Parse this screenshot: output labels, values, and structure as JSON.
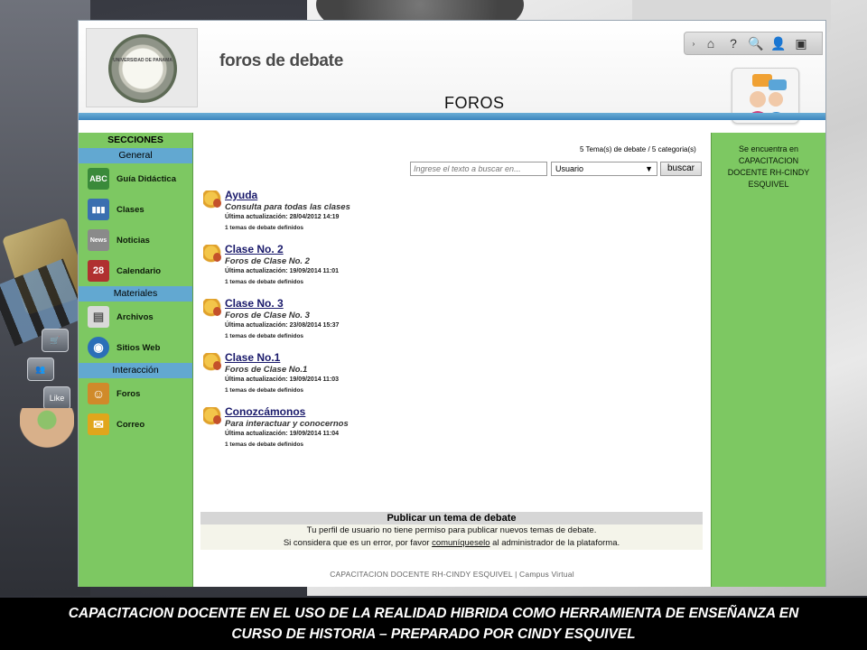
{
  "header": {
    "app_title": "foros de debate",
    "page_title": "FOROS",
    "logo_text": "UNIVERSIDAD DE PANAMA"
  },
  "toolbar": {
    "icons": [
      "chevron-right-icon",
      "home-icon",
      "help-icon",
      "search-icon",
      "user-icon",
      "profile-card-icon"
    ],
    "glyphs": [
      "›",
      "⌂",
      "?",
      "🔍",
      "👤",
      "▣"
    ]
  },
  "search": {
    "placeholder": "Ingrese el texto a buscar en...",
    "select_value": "Usuario",
    "button_label": "buscar"
  },
  "stats": {
    "text": "5 Tema(s) de debate /   5 categoria(s)"
  },
  "sidebar": {
    "title": "SECCIONES",
    "sections": [
      {
        "label": "General",
        "items": [
          {
            "label": "Guía Didáctica",
            "icon": "abc-book-icon",
            "glyph": "ABC",
            "color": "#3a8a3a"
          },
          {
            "label": "Clases",
            "icon": "binders-icon",
            "glyph": "▮▮▮",
            "color": "#3a6fb0"
          },
          {
            "label": "Noticias",
            "icon": "news-icon",
            "glyph": "News",
            "color": "#8a8a8a"
          },
          {
            "label": "Calendario",
            "icon": "calendar-icon",
            "glyph": "28",
            "color": "#b03030"
          }
        ]
      },
      {
        "label": "Materiales",
        "items": [
          {
            "label": "Archivos",
            "icon": "documents-icon",
            "glyph": "▤",
            "color": "#d9d9d9"
          },
          {
            "label": "Sitios Web",
            "icon": "globe-icon",
            "glyph": "◉",
            "color": "#2b6fb8"
          }
        ]
      },
      {
        "label": "Interacción",
        "items": [
          {
            "label": "Foros",
            "icon": "forum-users-icon",
            "glyph": "☺",
            "color": "#d08a2a"
          },
          {
            "label": "Correo",
            "icon": "envelope-icon",
            "glyph": "✉",
            "color": "#e0a61c"
          }
        ]
      }
    ]
  },
  "forums": [
    {
      "name": "Ayuda",
      "description": "Consulta para todas las clases",
      "updated": "Última actualización: 28/04/2012 14:19",
      "count": "1 temas de debate definidos"
    },
    {
      "name": "Clase No. 2",
      "description": "Foros de Clase No. 2",
      "updated": "Última actualización: 19/09/2014 11:01",
      "count": "1 temas de debate definidos"
    },
    {
      "name": "Clase No. 3",
      "description": "Foros de Clase No. 3",
      "updated": "Última actualización: 23/08/2014 15:37",
      "count": "1 temas de debate definidos"
    },
    {
      "name": "Clase No.1",
      "description": "Foros de Clase No.1",
      "updated": "Última actualización: 19/09/2014 11:03",
      "count": "1 temas de debate definidos"
    },
    {
      "name": "Conozcámonos",
      "description": "Para interactuar y conocernos",
      "updated": "Última actualización: 19/09/2014 11:04",
      "count": "1 temas de debate definidos"
    }
  ],
  "publish": {
    "title": "Publicar un tema de debate",
    "line1": "Tu perfil de usuario no tiene permiso para publicar nuevos temas de debate.",
    "line2_pre": "Si considera que es un error, por favor ",
    "line2_link": "comuníqueselo",
    "line2_post": " al administrador de la plataforma."
  },
  "footer": {
    "text": "CAPACITACION DOCENTE RH-CINDY ESQUIVEL | Campus Virtual"
  },
  "right_panel": {
    "lines": [
      "Se encuentra en",
      "CAPACITACION",
      "DOCENTE RH-CINDY",
      "ESQUIVEL"
    ]
  },
  "caption": {
    "line1": "CAPACITACION DOCENTE EN EL USO DE LA REALIDAD HIBRIDA COMO HERRAMIENTA DE ENSEÑANZA EN",
    "line2": "CURSO DE HISTORIA – PREPARADO POR CINDY ESQUIVEL"
  },
  "colors": {
    "sidebar_green": "#7dc862",
    "section_blue": "#62a8d1",
    "header_bar": "#3c86bd"
  }
}
